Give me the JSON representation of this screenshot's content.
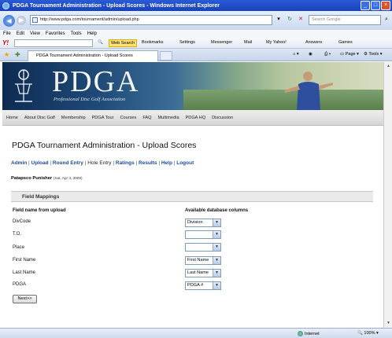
{
  "window": {
    "title": "PDGA Tournament Administration - Upload Scores - Windows Internet Explorer"
  },
  "browser": {
    "address": "http://www.pdga.com/tournament/admin/upload.php",
    "search_placeholder": "Search Google",
    "menu": [
      "File",
      "Edit",
      "View",
      "Favorites",
      "Tools",
      "Help"
    ],
    "toolbar": {
      "web_search": "Web Search",
      "bookmarks": "Bookmarks",
      "settings": "Settings",
      "messenger": "Messenger",
      "mail": "Mail",
      "my_yahoo": "My Yahoo!",
      "answers": "Answers",
      "games": "Games"
    },
    "tab_label": "PDGA Tournament Administration - Upload Scores",
    "page_label": "Page",
    "tools_label": "Tools",
    "status_zone": "Internet",
    "zoom": "100%"
  },
  "banner": {
    "logo": "PDGA",
    "tagline": "Professional Disc Golf Association"
  },
  "site_nav": [
    "Home",
    "About Disc Golf",
    "Membership",
    "PDGA Tour",
    "Courses",
    "FAQ",
    "Multimedia",
    "PDGA HQ",
    "Discussion"
  ],
  "page": {
    "title": "PDGA Tournament Administration - Upload Scores",
    "admin_links": {
      "admin": "Admin",
      "upload": "Upload",
      "round_entry": "Round Entry",
      "hole_entry": "Hole Entry",
      "ratings": "Ratings",
      "results": "Results",
      "help": "Help",
      "logout": "Logout"
    },
    "event_name": "Patapsco Punisher",
    "event_date": "(Sat, Apr 4, 2009)",
    "section_title": "Field Mappings",
    "col_upload": "Field name from upload",
    "col_db": "Available database columns",
    "mappings": [
      {
        "field": "DivCode",
        "selected": "Division"
      },
      {
        "field": "T.O.",
        "selected": ""
      },
      {
        "field": "Place",
        "selected": ""
      },
      {
        "field": "First Name",
        "selected": "First Name"
      },
      {
        "field": "Last Name",
        "selected": "Last Name"
      },
      {
        "field": "PDGA",
        "selected": "PDGA #"
      }
    ],
    "next_label": "Next>>"
  }
}
